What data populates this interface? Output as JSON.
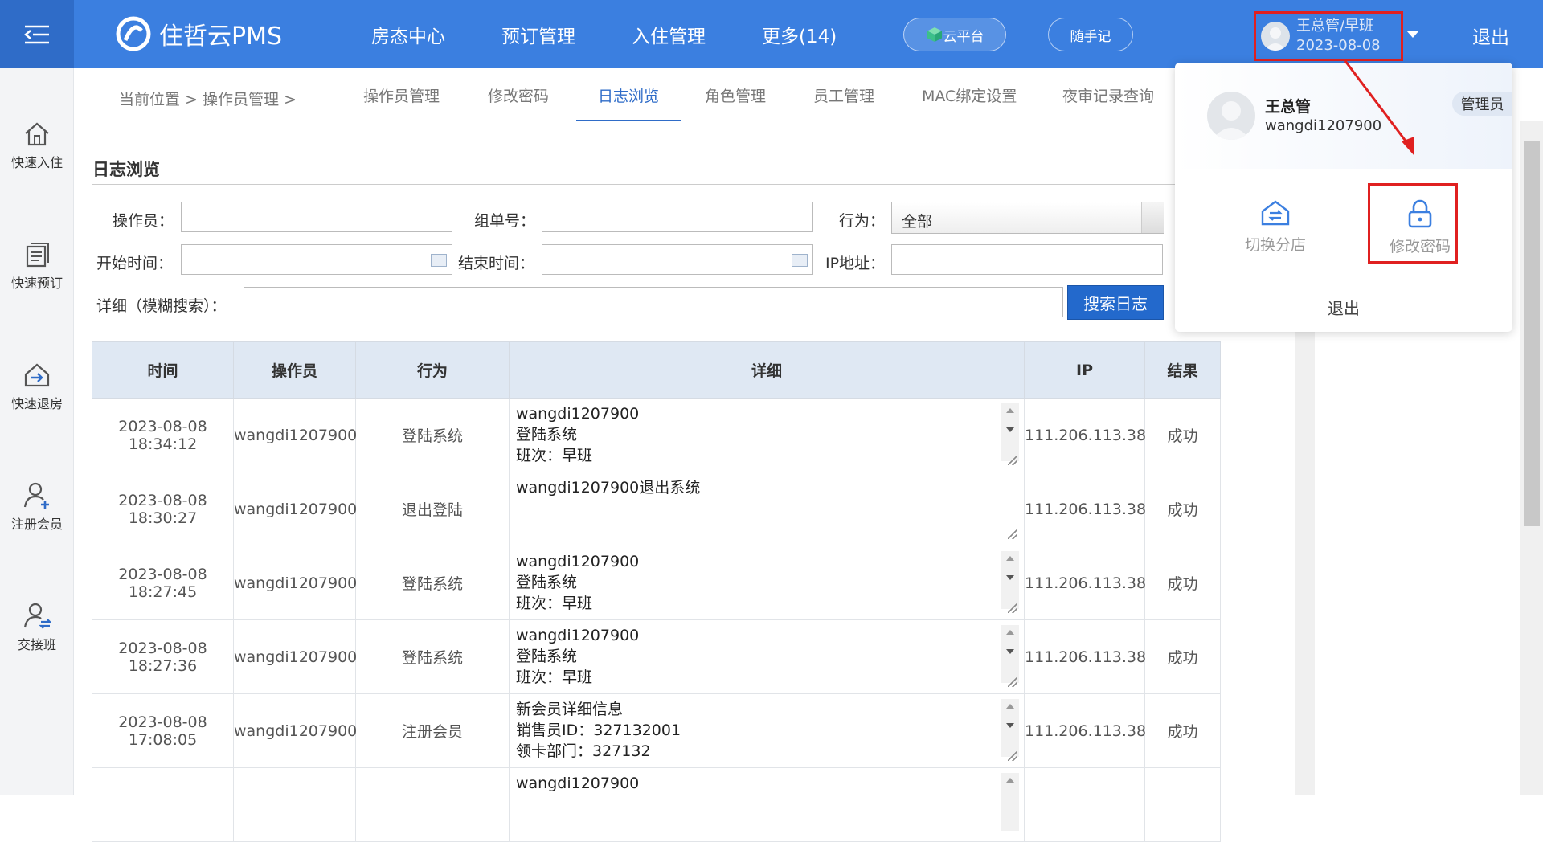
{
  "app": {
    "name": "住哲云PMS"
  },
  "nav": [
    "房态中心",
    "预订管理",
    "入住管理",
    "更多(14)"
  ],
  "pills": {
    "cloud": "云平台",
    "notes": "随手记"
  },
  "user": {
    "label": "王总管/早班",
    "date": "2023-08-08",
    "logout": "退出"
  },
  "sidebar": [
    {
      "label": "快速入住",
      "icon": "home-icon"
    },
    {
      "label": "快速预订",
      "icon": "booking-icon"
    },
    {
      "label": "快速退房",
      "icon": "checkout-icon"
    },
    {
      "label": "注册会员",
      "icon": "add-user-icon"
    },
    {
      "label": "交接班",
      "icon": "shift-handover-icon"
    }
  ],
  "breadcrumb": {
    "prefix": "当前位置",
    "sep": ">",
    "current": "操作员管理",
    "sep2": ">"
  },
  "tabs": [
    "操作员管理",
    "修改密码",
    "日志浏览",
    "角色管理",
    "员工管理",
    "MAC绑定设置",
    "夜审记录查询"
  ],
  "active_tab": "日志浏览",
  "section_title": "日志浏览",
  "filters": {
    "operator": "操作员：",
    "order": "组单号：",
    "action": "行为：",
    "action_value": "全部",
    "start": "开始时间：",
    "end": "结束时间：",
    "ip": "IP地址：",
    "detail": "详细（模糊搜索）：",
    "search": "搜索日志"
  },
  "table": {
    "headers": [
      "时间",
      "操作员",
      "行为",
      "详细",
      "IP",
      "结果"
    ],
    "rows": [
      {
        "date": "2023-08-08",
        "time": "18:34:12",
        "op": "wangdi1207900",
        "action": "登陆系统",
        "detail": [
          "wangdi1207900",
          "登陆系统",
          "班次：早班"
        ],
        "ip": "111.206.113.38",
        "result": "成功"
      },
      {
        "date": "2023-08-08",
        "time": "18:30:27",
        "op": "wangdi1207900",
        "action": "退出登陆",
        "detail": [
          "wangdi1207900退出系统",
          "",
          ""
        ],
        "ip": "111.206.113.38",
        "result": "成功"
      },
      {
        "date": "2023-08-08",
        "time": "18:27:45",
        "op": "wangdi1207900",
        "action": "登陆系统",
        "detail": [
          "wangdi1207900",
          "登陆系统",
          "班次：早班"
        ],
        "ip": "111.206.113.38",
        "result": "成功"
      },
      {
        "date": "2023-08-08",
        "time": "18:27:36",
        "op": "wangdi1207900",
        "action": "登陆系统",
        "detail": [
          "wangdi1207900",
          "登陆系统",
          "班次：早班"
        ],
        "ip": "111.206.113.38",
        "result": "成功"
      },
      {
        "date": "2023-08-08",
        "time": "17:08:05",
        "op": "wangdi1207900",
        "action": "注册会员",
        "detail": [
          "新会员详细信息",
          "销售员ID：327132001",
          "领卡部门：327132"
        ],
        "ip": "111.206.113.38",
        "result": "成功"
      },
      {
        "date": "",
        "time": "",
        "op": "",
        "action": "",
        "detail": [
          "wangdi1207900",
          "",
          ""
        ],
        "ip": "",
        "result": ""
      }
    ]
  },
  "dropdown": {
    "name": "王总管",
    "account": "wangdi1207900",
    "role": "管理员",
    "switch_store": "切换分店",
    "change_password": "修改密码",
    "logout": "退出"
  },
  "colors": {
    "primary": "#3b7fe0",
    "highlight": "#e02020"
  }
}
